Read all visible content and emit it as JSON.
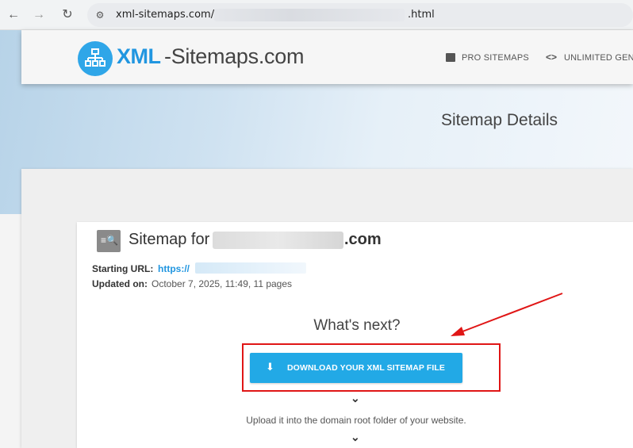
{
  "browser": {
    "back_icon": "arrow-left-icon",
    "forward_icon": "arrow-right-icon",
    "reload_icon": "reload-icon",
    "site_info_icon": "tune-icon",
    "url_prefix": "xml-sitemaps.com/",
    "url_suffix": ".html"
  },
  "header": {
    "logo_bold": "XML",
    "logo_rest": "-Sitemaps.com",
    "nav": {
      "pro_label": "PRO SITEMAPS",
      "unlimited_icon": "<>",
      "unlimited_label": "UNLIMITED GENE"
    }
  },
  "page": {
    "heading": "Sitemap Details"
  },
  "sitemap": {
    "title_prefix": "Sitemap for",
    "title_suffix": ".com",
    "starting_url_label": "Starting URL:",
    "starting_url_value": "https://",
    "updated_label": "Updated on:",
    "updated_value": "October 7, 2025, 11:49, 11 pages"
  },
  "next_steps": {
    "heading": "What's next?",
    "download_label": "DOWNLOAD YOUR XML SITEMAP FILE",
    "upload_instruction": "Upload it into the domain root folder of your website."
  },
  "colors": {
    "brand_blue": "#2196e0",
    "button_blue": "#22a9e6",
    "annotation_red": "#e01616"
  }
}
